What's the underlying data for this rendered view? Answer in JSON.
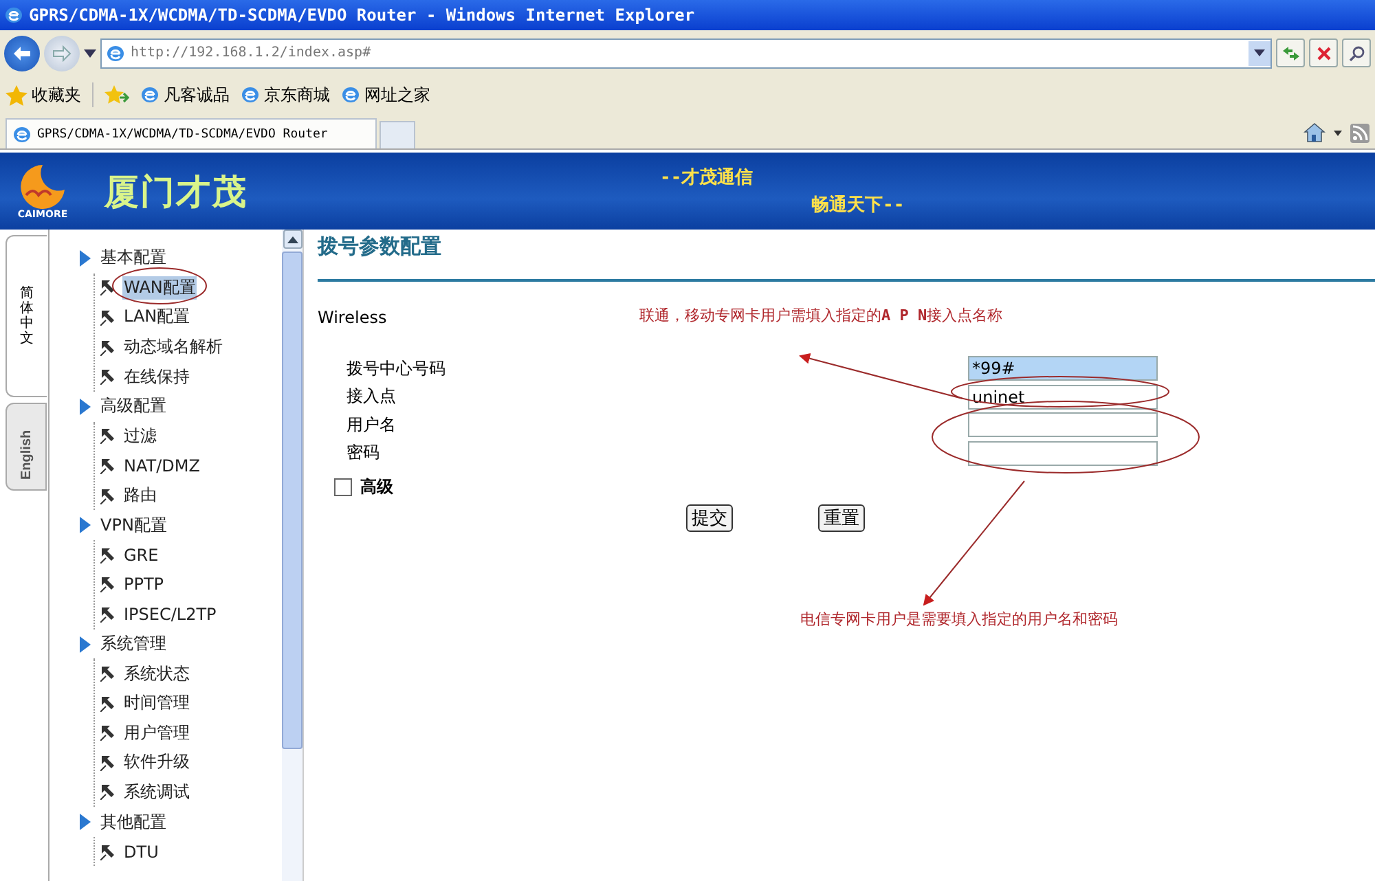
{
  "window": {
    "title": "GPRS/CDMA-1X/WCDMA/TD-SCDMA/EVDO Router - Windows Internet Explorer"
  },
  "browser": {
    "address": "http://192.168.1.2/index.asp#",
    "favorites_label": "收藏夹",
    "favorites": [
      "凡客诚品",
      "京东商城",
      "网址之家"
    ],
    "tab_title": "GPRS/CDMA-1X/WCDMA/TD-SCDMA/EVDO Router"
  },
  "banner": {
    "logo_text": "CAIMORE",
    "brand": "厦门才茂",
    "slogans": [
      "--才茂通信",
      "畅通天下--"
    ]
  },
  "lang_tabs": [
    {
      "label": "简体中文",
      "selected": true
    },
    {
      "label": "English",
      "selected": false
    }
  ],
  "nav": [
    {
      "label": "基本配置",
      "children": [
        {
          "label": "WAN配置",
          "selected": true
        },
        {
          "label": "LAN配置",
          "selected": false
        },
        {
          "label": "动态域名解析",
          "selected": false
        },
        {
          "label": "在线保持",
          "selected": false
        }
      ]
    },
    {
      "label": "高级配置",
      "children": [
        {
          "label": "过滤",
          "selected": false
        },
        {
          "label": "NAT/DMZ",
          "selected": false
        },
        {
          "label": "路由",
          "selected": false
        }
      ]
    },
    {
      "label": "VPN配置",
      "children": [
        {
          "label": "GRE",
          "selected": false
        },
        {
          "label": "PPTP",
          "selected": false
        },
        {
          "label": "IPSEC/L2TP",
          "selected": false
        }
      ]
    },
    {
      "label": "系统管理",
      "children": [
        {
          "label": "系统状态",
          "selected": false
        },
        {
          "label": "时间管理",
          "selected": false
        },
        {
          "label": "用户管理",
          "selected": false
        },
        {
          "label": "软件升级",
          "selected": false
        },
        {
          "label": "系统调试",
          "selected": false
        }
      ]
    },
    {
      "label": "其他配置",
      "children": [
        {
          "label": "DTU",
          "selected": false
        }
      ]
    }
  ],
  "form": {
    "title": "拨号参数配置",
    "section": "Wireless",
    "fields": [
      {
        "label": "拨号中心号码",
        "value": "*99#",
        "selected": true
      },
      {
        "label": "接入点",
        "value": "uninet",
        "selected": false
      },
      {
        "label": "用户名",
        "selected": false
      },
      {
        "label": "密码",
        "selected": false
      }
    ],
    "advanced": {
      "label": "高级",
      "checked": false
    },
    "buttons": [
      "提交",
      "重置"
    ]
  },
  "annotations": [
    "联通，移动专网卡用户需填入指定的**A P N**接入点名称",
    "电信专网卡用户是需要填入指定的用户名和密码"
  ]
}
